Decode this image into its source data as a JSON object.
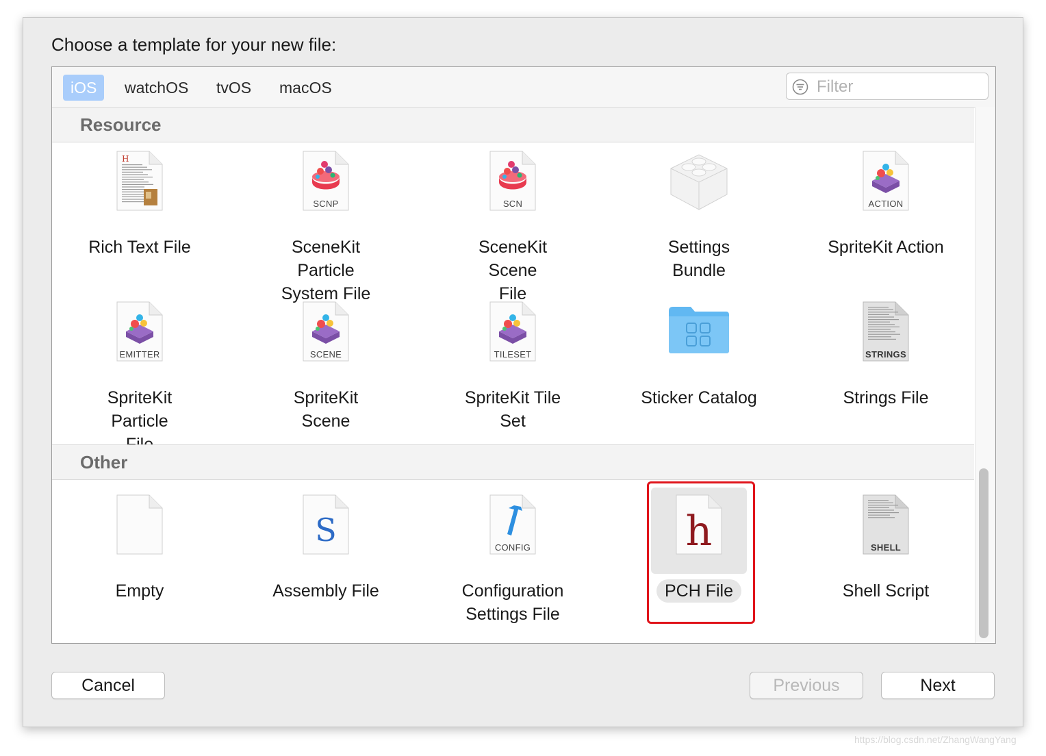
{
  "dialog": {
    "prompt": "Choose a template for your new file:"
  },
  "tabs": [
    {
      "label": "iOS",
      "selected": true
    },
    {
      "label": "watchOS",
      "selected": false
    },
    {
      "label": "tvOS",
      "selected": false
    },
    {
      "label": "macOS",
      "selected": false
    }
  ],
  "filter": {
    "placeholder": "Filter",
    "value": ""
  },
  "sections": {
    "resource": {
      "title": "Resource",
      "items": [
        {
          "label_lines": [
            "Rich Text File"
          ],
          "icon": "rich-text-document-icon",
          "tag": ""
        },
        {
          "label_lines": [
            "SceneKit Particle",
            "System File"
          ],
          "icon": "scenekit-particle-icon",
          "tag": "SCNP"
        },
        {
          "label_lines": [
            "SceneKit Scene",
            "File"
          ],
          "icon": "scenekit-scene-icon",
          "tag": "SCN"
        },
        {
          "label_lines": [
            "Settings Bundle"
          ],
          "icon": "lego-brick-icon",
          "tag": ""
        },
        {
          "label_lines": [
            "SpriteKit Action"
          ],
          "icon": "spritekit-action-icon",
          "tag": "ACTION"
        },
        {
          "label_lines": [
            "SpriteKit Particle",
            "File"
          ],
          "icon": "spritekit-emitter-icon",
          "tag": "EMITTER"
        },
        {
          "label_lines": [
            "SpriteKit Scene"
          ],
          "icon": "spritekit-scene-icon",
          "tag": "SCENE"
        },
        {
          "label_lines": [
            "SpriteKit Tile Set"
          ],
          "icon": "spritekit-tileset-icon",
          "tag": "TILESET"
        },
        {
          "label_lines": [
            "Sticker Catalog"
          ],
          "icon": "folder-icon",
          "tag": ""
        },
        {
          "label_lines": [
            "Strings File"
          ],
          "icon": "strings-file-icon",
          "tag": "STRINGS"
        }
      ]
    },
    "other": {
      "title": "Other",
      "items": [
        {
          "label_lines": [
            "Empty"
          ],
          "icon": "blank-document-icon",
          "tag": ""
        },
        {
          "label_lines": [
            "Assembly File"
          ],
          "icon": "assembly-s-icon",
          "tag": "",
          "glyph": "S"
        },
        {
          "label_lines": [
            "Configuration",
            "Settings File"
          ],
          "icon": "config-hammer-icon",
          "tag": "CONFIG"
        },
        {
          "label_lines": [
            "PCH File"
          ],
          "icon": "header-h-icon",
          "tag": "",
          "glyph": "h",
          "selected": true
        },
        {
          "label_lines": [
            "Shell Script"
          ],
          "icon": "shell-script-icon",
          "tag": "SHELL"
        }
      ]
    }
  },
  "buttons": {
    "cancel": "Cancel",
    "previous": "Previous",
    "next": "Next"
  },
  "watermark": "https://blog.csdn.net/ZhangWangYang",
  "colors": {
    "selection_tab": "#a9cdfb",
    "highlight_outline": "#e0141b",
    "spritekit_purple": "#7b4fa6",
    "scenekit_red": "#e83a4f"
  }
}
